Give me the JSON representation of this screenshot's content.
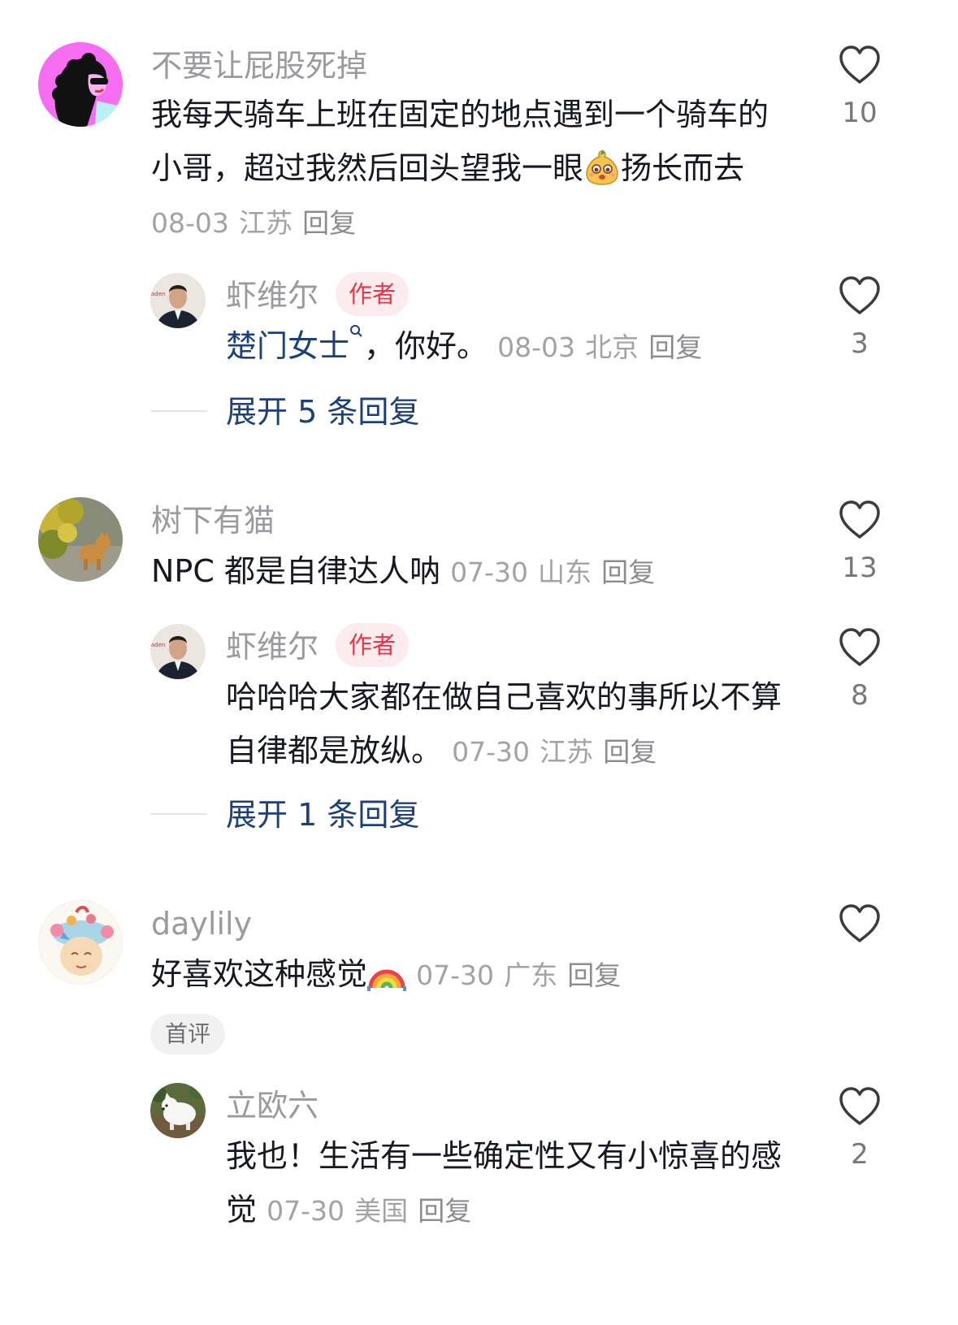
{
  "colors": {
    "author_tag": "#e93549",
    "link_blue": "#1d3f7a",
    "meta_gray": "#a2a2a7"
  },
  "comments": [
    {
      "username": "不要让屁股死掉",
      "text_before_emoji": "我每天骑车上班在固定的地点遇到一个骑车的小哥，超过我然后回头望我一眼",
      "emoji": "smiling-pear-emoji",
      "text_after_emoji": "扬长而去",
      "date": "08-03",
      "location": "江苏",
      "reply_label": "回复",
      "likes": "10",
      "avatar": "woman-cartoon-avatar",
      "reply": {
        "username": "虾维尔",
        "tag": "作者",
        "mention": "楚门女士",
        "text": "，你好。",
        "date": "08-03",
        "location": "北京",
        "reply_label": "回复",
        "likes": "3",
        "avatar": "man-portrait-avatar"
      },
      "expand_label": "展开 5 条回复"
    },
    {
      "username": "树下有猫",
      "text": "NPC 都是自律达人呐",
      "date": "07-30",
      "location": "山东",
      "reply_label": "回复",
      "likes": "13",
      "avatar": "cat-photo-avatar",
      "reply": {
        "username": "虾维尔",
        "tag": "作者",
        "text": "哈哈哈大家都在做自己喜欢的事所以不算自律都是放纵。",
        "date": "07-30",
        "location": "江苏",
        "reply_label": "回复",
        "likes": "8",
        "avatar": "man-portrait-avatar"
      },
      "expand_label": "展开 1 条回复"
    },
    {
      "username": "daylily",
      "text": "好喜欢这种感觉",
      "emoji": "rainbow-emoji",
      "date": "07-30",
      "location": "广东",
      "reply_label": "回复",
      "likes": "",
      "badge": "首评",
      "avatar": "illustrated-face-avatar",
      "reply": {
        "username": "立欧六",
        "text": "我也！生活有一些确定性又有小惊喜的感觉",
        "date": "07-30",
        "location": "美国",
        "reply_label": "回复",
        "likes": "2",
        "avatar": "white-dog-avatar"
      }
    }
  ]
}
